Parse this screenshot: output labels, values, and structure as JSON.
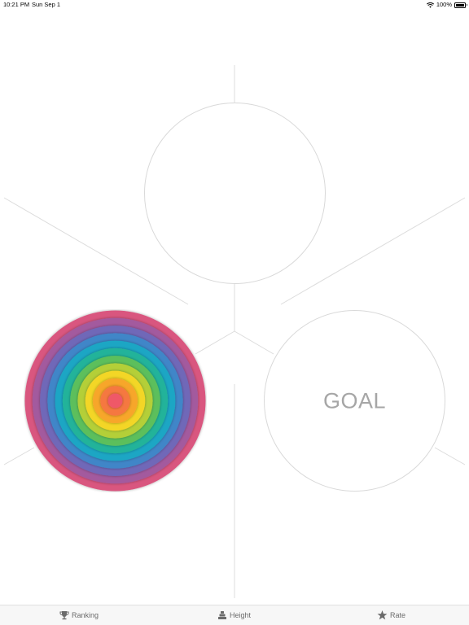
{
  "status_bar": {
    "time": "10:21 PM",
    "date": "Sun Sep 1",
    "battery": "100%",
    "icons": [
      "wifi-icon",
      "battery-icon"
    ]
  },
  "board": {
    "goal_label": "GOAL",
    "disc_colors": [
      "#d9577f",
      "#a35a9e",
      "#6f67b8",
      "#3f86c8",
      "#1aa6c4",
      "#23b39a",
      "#5bbf5c",
      "#b4cf38",
      "#f3d625",
      "#f7a62c",
      "#f5783f",
      "#ef5968"
    ],
    "line_color": "#d9d9d9"
  },
  "tab_bar": {
    "tabs": [
      {
        "label": "Ranking",
        "icon": "trophy-icon"
      },
      {
        "label": "Height",
        "icon": "stack-icon"
      },
      {
        "label": "Rate",
        "icon": "star-icon"
      }
    ]
  }
}
